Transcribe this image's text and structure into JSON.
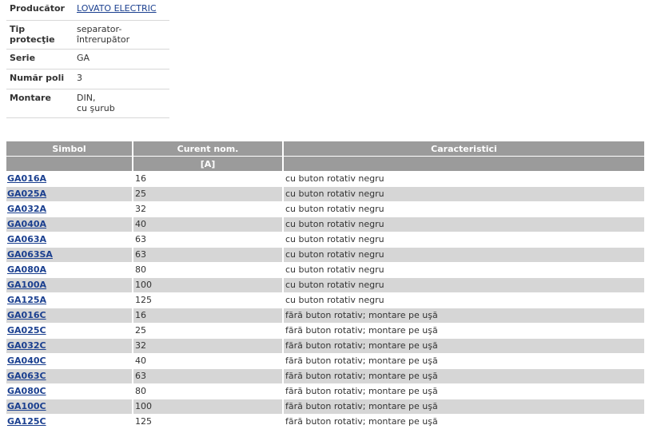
{
  "attributes": [
    {
      "label": "Producător",
      "value": "LOVATO ELECTRIC",
      "link": true
    },
    {
      "label": "Tip protecţie",
      "value": "separator-întrerupător",
      "link": false
    },
    {
      "label": "Serie",
      "value": "GA",
      "link": false
    },
    {
      "label": "Număr poli",
      "value": "3",
      "link": false
    },
    {
      "label": "Montare",
      "value": "DIN,",
      "value2": "cu şurub",
      "link": false
    }
  ],
  "table": {
    "headers": [
      "Simbol",
      "Curent nom.",
      "Caracteristici"
    ],
    "subheaders": [
      "",
      "[A]",
      ""
    ],
    "rows": [
      {
        "symbol": "GA016A",
        "current": "16",
        "feature": "cu buton rotativ negru"
      },
      {
        "symbol": "GA025A",
        "current": "25",
        "feature": "cu buton rotativ negru"
      },
      {
        "symbol": "GA032A",
        "current": "32",
        "feature": "cu buton rotativ negru"
      },
      {
        "symbol": "GA040A",
        "current": "40",
        "feature": "cu buton rotativ negru"
      },
      {
        "symbol": "GA063A",
        "current": "63",
        "feature": "cu buton rotativ negru"
      },
      {
        "symbol": "GA063SA",
        "current": "63",
        "feature": "cu buton rotativ negru"
      },
      {
        "symbol": "GA080A",
        "current": "80",
        "feature": "cu buton rotativ negru"
      },
      {
        "symbol": "GA100A",
        "current": "100",
        "feature": "cu buton rotativ negru"
      },
      {
        "symbol": "GA125A",
        "current": "125",
        "feature": "cu buton rotativ negru"
      },
      {
        "symbol": "GA016C",
        "current": "16",
        "feature": "fără buton rotativ; montare pe uşă"
      },
      {
        "symbol": "GA025C",
        "current": "25",
        "feature": "fără buton rotativ; montare pe uşă"
      },
      {
        "symbol": "GA032C",
        "current": "32",
        "feature": "fără buton rotativ; montare pe uşă"
      },
      {
        "symbol": "GA040C",
        "current": "40",
        "feature": "fără buton rotativ; montare pe uşă"
      },
      {
        "symbol": "GA063C",
        "current": "63",
        "feature": "fără buton rotativ; montare pe uşă"
      },
      {
        "symbol": "GA080C",
        "current": "80",
        "feature": "fără buton rotativ; montare pe uşă"
      },
      {
        "symbol": "GA100C",
        "current": "100",
        "feature": "fără buton rotativ; montare pe uşă"
      },
      {
        "symbol": "GA125C",
        "current": "125",
        "feature": "fără buton rotativ; montare pe uşă"
      }
    ]
  },
  "colors": {
    "header_bg": "#9b9b9b",
    "row_alt_bg": "#d6d6d6",
    "link": "#1a3f8f"
  }
}
